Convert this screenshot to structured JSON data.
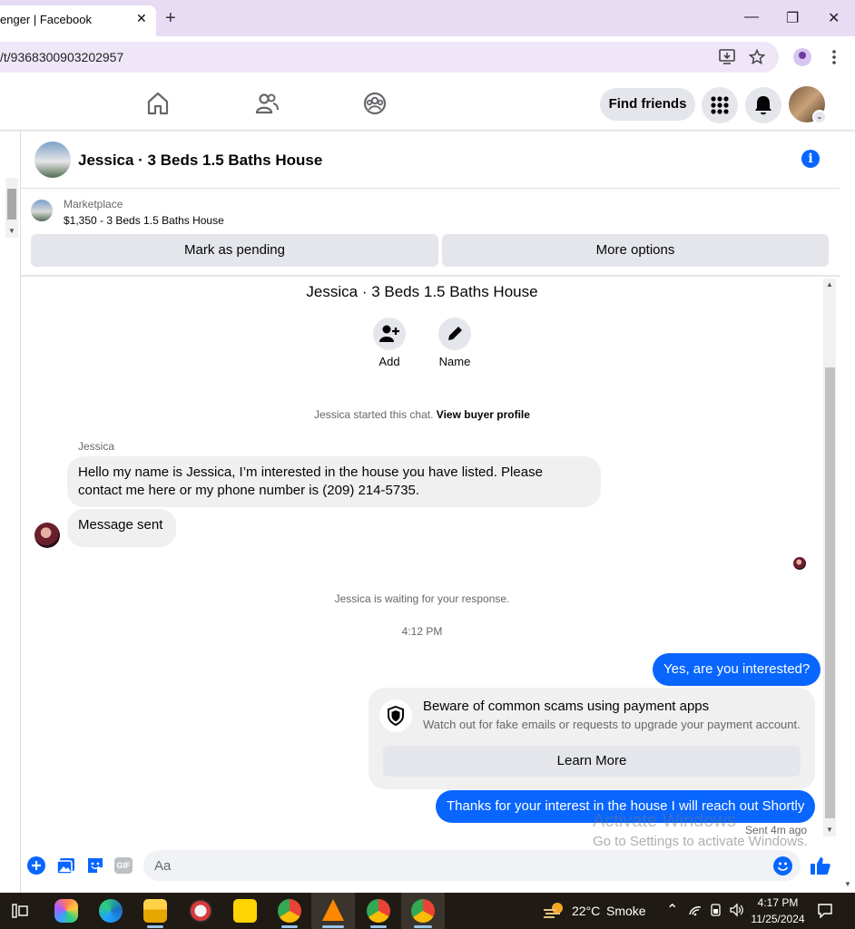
{
  "browser": {
    "tab_title": "enger | Facebook",
    "tab_close": "✕",
    "new_tab": "+",
    "url": "/t/9368300903202957",
    "window_buttons": [
      "—",
      "❐",
      "✕"
    ]
  },
  "fb_nav": {
    "icons": [
      "home-icon",
      "friends-icon",
      "groups-icon"
    ],
    "find_friends_label": "Find friends",
    "menu_icon": "grid-menu-icon",
    "notifications_icon": "bell-icon"
  },
  "chat_header": {
    "title": "Jessica · 3 Beds 1.5 Baths House",
    "info_glyph": "i"
  },
  "marketplace": {
    "label": "Marketplace",
    "listing": "$1,350 - 3 Beds 1.5 Baths House",
    "mark_pending_label": "Mark as pending",
    "more_options_label": "More options"
  },
  "conversation": {
    "title": "Jessica · 3 Beds 1.5 Baths House",
    "add_label": "Add",
    "name_label": "Name",
    "started_text": "Jessica started this chat.",
    "view_profile_link": "View buyer profile",
    "sender_name": "Jessica",
    "incoming_message": "Hello my name is Jessica, I’m interested in the house you have listed. Please contact me here or my phone number is (209) 214-5735.",
    "incoming_message_2": "Message sent",
    "waiting_text": "Jessica is waiting for your response.",
    "timestamp": "4:12 PM",
    "outgoing_message_1": "Yes, are you interested?",
    "scam_title": "Beware of common scams using payment apps",
    "scam_subtitle": "Watch out for fake emails or requests to upgrade your payment account.",
    "learn_more_label": "Learn More",
    "outgoing_message_2": "Thanks for your interest in the house I will reach out Shortly",
    "sent_status": "Sent 4m ago"
  },
  "watermark": {
    "line1": "Activate Windows",
    "line2": "Go to Settings to activate Windows."
  },
  "composer": {
    "placeholder": "Aa",
    "gif_label": "GIF"
  },
  "taskbar": {
    "weather_temp": "22°C",
    "weather_desc": "Smoke",
    "time": "4:17 PM",
    "date": "11/25/2024"
  },
  "colors": {
    "messenger_blue": "#0866ff",
    "bubble_gray": "#f0f0f0",
    "button_gray": "#e4e6eb",
    "tab_bar": "#e8dcf5"
  }
}
